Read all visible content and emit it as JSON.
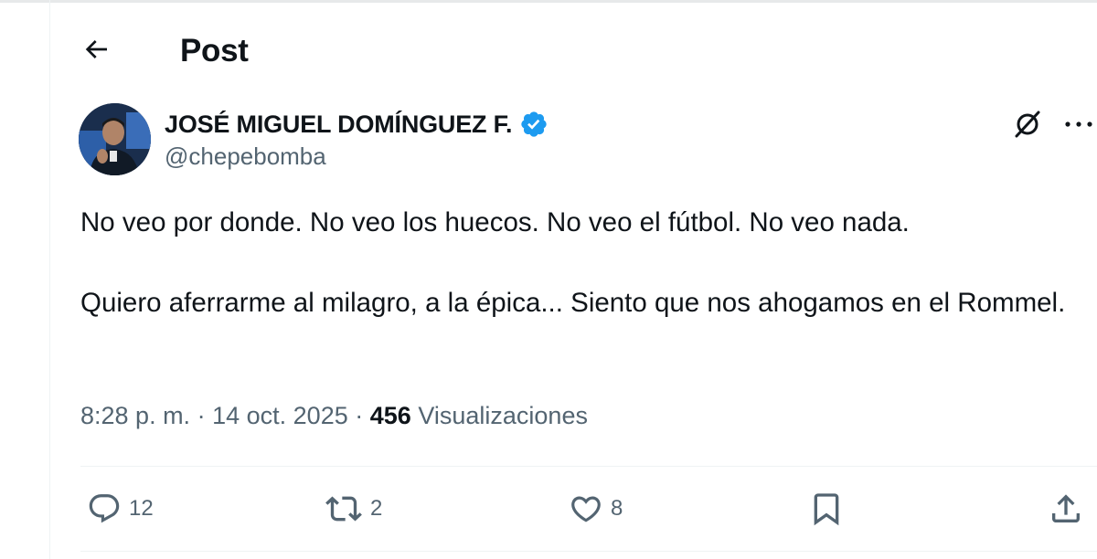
{
  "header": {
    "title": "Post"
  },
  "author": {
    "name": "JOSÉ MIGUEL DOMÍNGUEZ F.",
    "handle": "@chepebomba",
    "verified": true
  },
  "tweet": {
    "paragraphs": [
      "No veo por donde. No veo los huecos. No veo el fútbol. No veo nada.",
      "Quiero aferrarme al milagro, a la épica... Siento que nos ahogamos en el Rommel."
    ]
  },
  "meta": {
    "time": "8:28 p. m.",
    "separator": "·",
    "date": "14 oct. 2025",
    "views_count": "456",
    "views_label": "Visualizaciones"
  },
  "actions": {
    "reply_count": "12",
    "repost_count": "2",
    "like_count": "8"
  },
  "icons": {
    "back": "back-arrow-icon",
    "verified": "verified-badge-icon",
    "grok": "grok-icon",
    "more": "more-icon",
    "reply": "reply-icon",
    "repost": "repost-icon",
    "like": "heart-icon",
    "bookmark": "bookmark-icon",
    "share": "share-icon"
  },
  "colors": {
    "text_primary": "#0f1419",
    "text_secondary": "#536471",
    "verified_blue": "#1d9bf0",
    "border": "#eff3f4"
  }
}
